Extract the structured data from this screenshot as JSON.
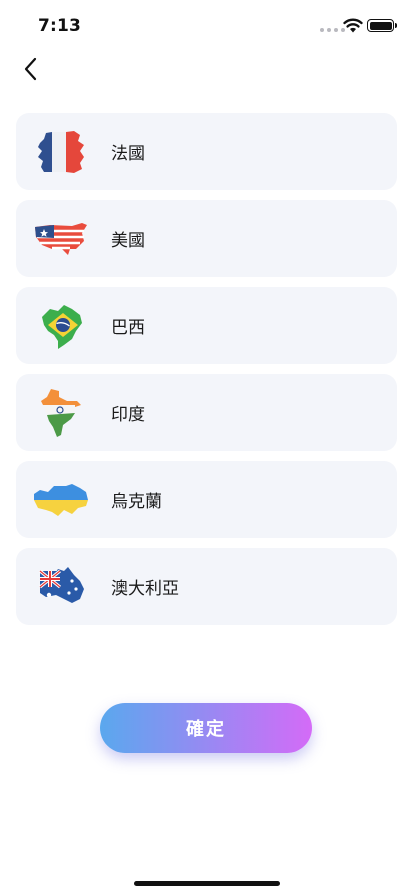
{
  "status_bar": {
    "time": "7:13",
    "icons": [
      "signal-dots-icon",
      "wifi-icon",
      "battery-icon"
    ]
  },
  "nav": {
    "back_icon": "chevron-left-icon"
  },
  "countries": [
    {
      "name": "法國",
      "icon": "france-map-flag-icon"
    },
    {
      "name": "美國",
      "icon": "usa-map-flag-icon"
    },
    {
      "name": "巴西",
      "icon": "brazil-map-flag-icon"
    },
    {
      "name": "印度",
      "icon": "india-map-flag-icon"
    },
    {
      "name": "烏克蘭",
      "icon": "ukraine-map-flag-icon"
    },
    {
      "name": "澳大利亞",
      "icon": "australia-map-flag-icon"
    }
  ],
  "confirm_label": "確定",
  "colors": {
    "card_bg": "#f3f5fa",
    "button_gradient_start": "#5aa8ee",
    "button_gradient_end": "#d46bf7"
  }
}
